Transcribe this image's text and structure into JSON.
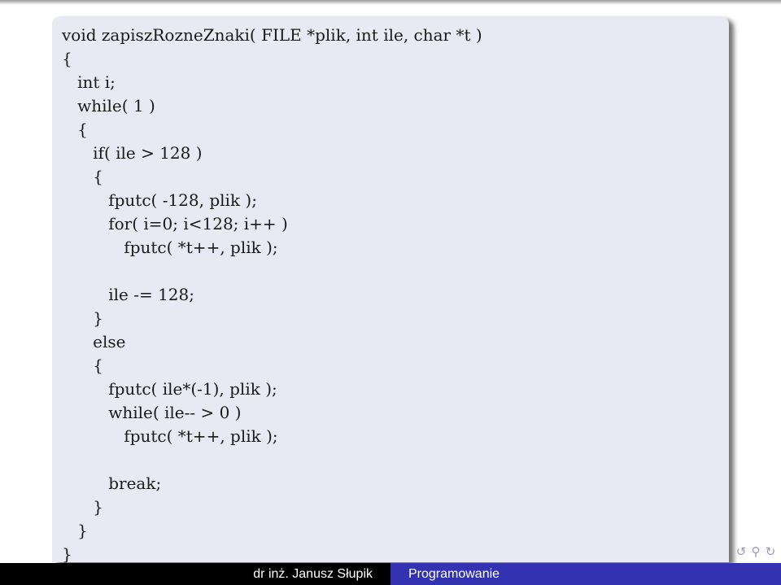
{
  "code": {
    "lines": [
      "void zapiszRozneZnaki( FILE *plik, int ile, char *t )",
      "{",
      "   int i;",
      "   while( 1 )",
      "   {",
      "      if( ile > 128 )",
      "      {",
      "         fputc( -128, plik );",
      "         for( i=0; i<128; i++ )",
      "            fputc( *t++, plik );",
      "",
      "         ile -= 128;",
      "      }",
      "      else",
      "      {",
      "         fputc( ile*(-1), plik );",
      "         while( ile-- > 0 )",
      "            fputc( *t++, plik );",
      "",
      "         break;",
      "      }",
      "   }",
      "}"
    ]
  },
  "navigation": {
    "icons": [
      {
        "name": "undo-icon",
        "glyph": "↺"
      },
      {
        "name": "search-icon",
        "glyph": "⚲"
      },
      {
        "name": "redo-icon",
        "glyph": "↻"
      }
    ]
  },
  "footer": {
    "author": "dr inż. Janusz Słupik",
    "title": "Programowanie"
  },
  "colors": {
    "block_background": "#e9e9f3",
    "footer_left": "#000000",
    "footer_right": "#3333b2"
  }
}
